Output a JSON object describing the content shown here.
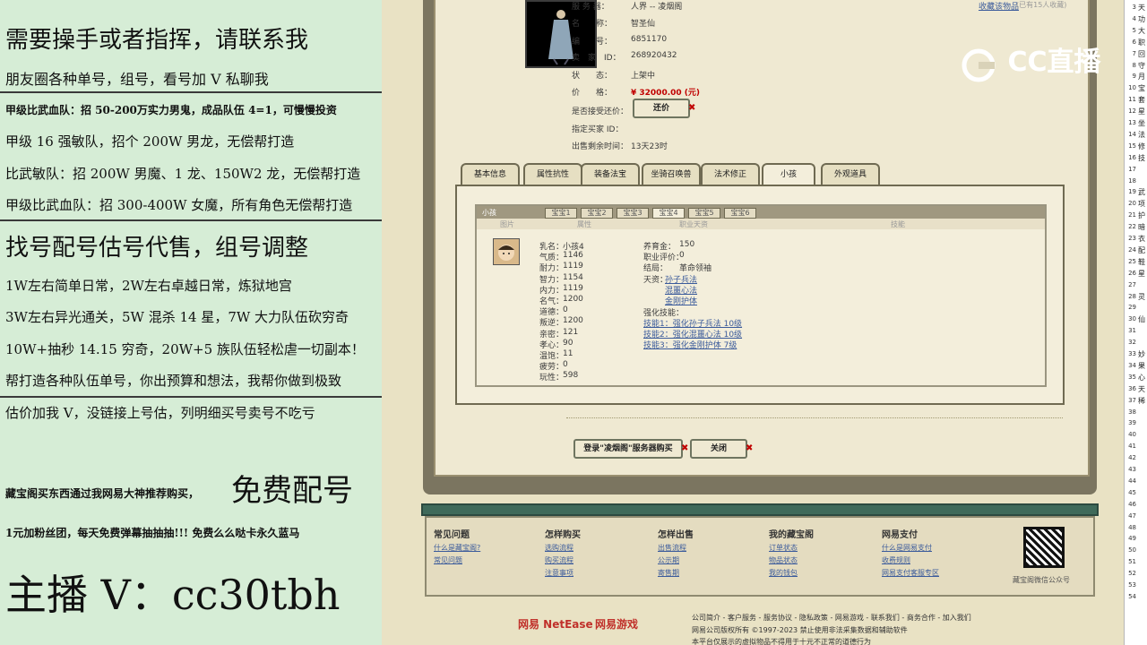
{
  "overlay": {
    "lines": [
      "需要操手或者指挥，请联系我",
      "朋友圈各种单号，组号，看号加 V 私聊我",
      "甲级比武血队：招 50-200万实力男鬼，成品队伍 4=1，可慢慢投资",
      "甲级 16 强敏队，招个 200W 男龙，无偿帮打造",
      "比武敏队：招 200W 男魔、1 龙、150W2 龙，无偿帮打造",
      "甲级比武血队：招 300-400W 女魔，所有角色无偿帮打造",
      "找号配号估号代售，组号调整",
      "1W左右简单日常，2W左右卓越日常，炼狱地宫",
      "3W左右异光通关，5W 混杀 14 星，7W 大力队伍砍穷奇",
      "10W+抽秒 14.15 穷奇，20W+5 族队伍轻松虐一切副本！",
      "帮打造各种队伍单号，你出预算和想法，我帮你做到极致",
      "估价加我 V，没链接上号估，列明细买号卖号不吃亏",
      "藏宝阁买东西通过我网易大神推荐购买，",
      "免费配号",
      "1元加粉丝团，每天免费弹幕抽抽抽!!! 免费么么哒卡永久蓝马",
      "主播 V：cc30tbh"
    ]
  },
  "info": {
    "server_label": "服 务 器：",
    "server_value": "人界 -- 凌烟阁",
    "name_label": "名　　称：",
    "name_value": "智圣仙",
    "id_label": "编　　号：",
    "id_value": "6851170",
    "seller_label": "卖　家　ID：",
    "seller_value": "268920432",
    "status_label": "状　　态：",
    "status_value": "上架中",
    "price_label": "价　　格：",
    "price_value": "¥ 32000.00 (元)",
    "bargain_label": "是否接受还价：",
    "bargain_button": "还价",
    "buyer_label": "指定买家 ID：",
    "remain_label": "出售剩余时间：",
    "remain_value": "13天23时",
    "collect": "收藏该物品",
    "collect_count": "(已有15人收藏)"
  },
  "tabs": [
    "基本信息",
    "属性抗性",
    "装备法宝",
    "坐骑召唤兽",
    "法术修正",
    "小孩",
    "外观道具"
  ],
  "kid": {
    "title": "小孩",
    "subtabs": [
      "宝宝1",
      "宝宝2",
      "宝宝3",
      "宝宝4",
      "宝宝5",
      "宝宝6"
    ],
    "col_headers": [
      "图片",
      "属性",
      "职业天资",
      "技能"
    ],
    "stats": [
      [
        "乳名：",
        "小孩4"
      ],
      [
        "气质：",
        "1146"
      ],
      [
        "耐力：",
        "1119"
      ],
      [
        "智力：",
        "1154"
      ],
      [
        "内力：",
        "1119"
      ],
      [
        "名气：",
        "1200"
      ],
      [
        "道德：",
        "0"
      ],
      [
        "叛逆：",
        "1200"
      ],
      [
        "亲密：",
        "121"
      ],
      [
        "孝心：",
        "90"
      ],
      [
        "温饱：",
        "11"
      ],
      [
        "疲劳：",
        "0"
      ],
      [
        "玩性：",
        "598"
      ]
    ],
    "career": [
      [
        "养育金：",
        "150"
      ],
      [
        "职业评价：",
        "0"
      ],
      [
        "结局：",
        "革命领袖"
      ]
    ],
    "talent_label": "天资：",
    "talents": [
      "孙子兵法",
      "混噩心法",
      "金刚护体"
    ],
    "skills_label": "强化技能：",
    "skills": [
      "技能1：强化孙子兵法 10级",
      "技能2：强化混噩心法 10级",
      "技能3：强化金刚护体 7级"
    ]
  },
  "buttons": {
    "login_buy": "登录\"凌烟阁\"服务器购买",
    "close": "关闭"
  },
  "footer": {
    "cols": [
      {
        "title": "常见问题",
        "links": [
          "什么是藏宝阁?",
          "常见问题"
        ]
      },
      {
        "title": "怎样购买",
        "links": [
          "选购流程",
          "购买流程",
          "注意事项"
        ]
      },
      {
        "title": "怎样出售",
        "links": [
          "出售流程",
          "公示期",
          "寄售期"
        ]
      },
      {
        "title": "我的藏宝阁",
        "links": [
          "订单状态",
          "物品状态",
          "我的钱包"
        ]
      },
      {
        "title": "网易支付",
        "links": [
          "什么是网易支付",
          "收费规则",
          "网易支付客服专区"
        ]
      }
    ],
    "qr_caption": "藏宝阁微信公众号",
    "brand_netease": "网易 NetEase",
    "brand_games": "网易游戏",
    "bottom_links": "公司简介 - 客户服务 - 服务协议 - 隐私政策 - 网易游戏 - 联系我们 - 商务合作 - 加入我们",
    "copyright": "网易公司版权所有 ©1997-2023  禁止使用非法采集数据和辅助软件",
    "truncated": "本平台仅展示的虚拟物品不得用于十元不正常的道德行为"
  },
  "watermark": "CC直播",
  "sheet": {
    "rows": [
      "3",
      "4",
      "5",
      "6",
      "7",
      "8",
      "9",
      "10",
      "11",
      "12",
      "13",
      "14",
      "15",
      "16",
      "17",
      "18",
      "19",
      "20",
      "21",
      "22",
      "23",
      "24",
      "25",
      "26",
      "27",
      "28",
      "29",
      "30",
      "31",
      "32",
      "33",
      "34",
      "35",
      "36",
      "37",
      "38",
      "39",
      "40",
      "41",
      "42",
      "43",
      "44",
      "45",
      "46",
      "47",
      "48",
      "49",
      "50",
      "51",
      "52",
      "53",
      "54"
    ],
    "chars": [
      "天",
      "功",
      "大",
      "职",
      "回",
      "守",
      "月",
      "宝",
      "套",
      "星",
      "坐",
      "法",
      "修",
      "技",
      "",
      "",
      "武",
      "项",
      "护",
      "暗",
      "衣",
      "配",
      "鞋",
      "星",
      "",
      "灵",
      "",
      "仙",
      "",
      "",
      "妙",
      "果",
      "心",
      "天",
      "稀"
    ]
  }
}
